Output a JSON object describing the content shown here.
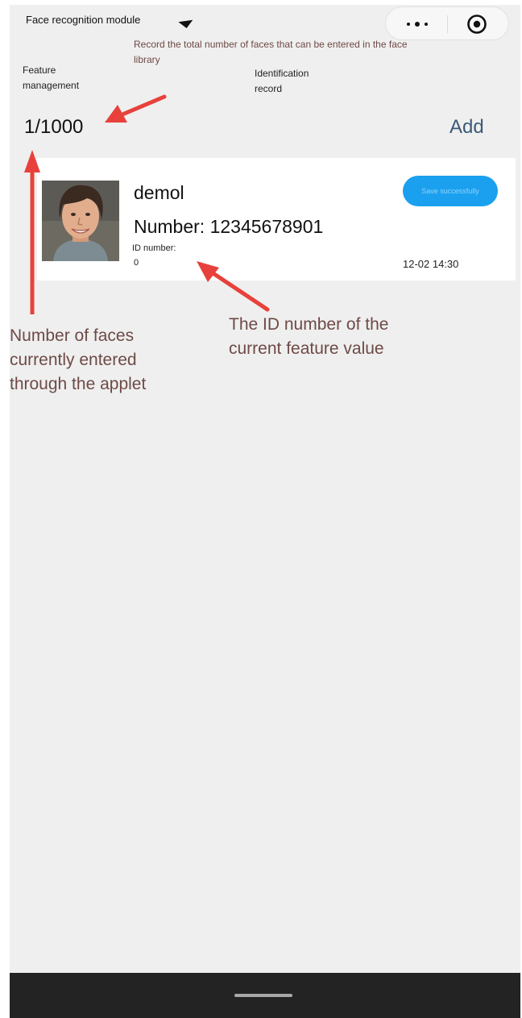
{
  "header": {
    "title": "Face recognition module",
    "tab_feature": "Feature management",
    "tab_record": "Identification record"
  },
  "library": {
    "count_label": "1/1000",
    "add_label": "Add"
  },
  "record": {
    "name": "demol",
    "number": "Number: 12345678901",
    "id_label": "ID number:",
    "id_value": "0",
    "status": "Save successfully",
    "time": "12-02 14:30"
  },
  "annotations": {
    "total_capacity": "Record the total number of faces that can be entered in the face library",
    "current_count": "Number of faces currently entered through the applet",
    "id_number": "The ID number of the current feature value"
  },
  "colors": {
    "annotation_text": "#6e4a46",
    "arrow": "#e8413b",
    "status_button": "#1aa0ee",
    "add_link": "#3c5a78"
  },
  "icons": {
    "capsule_more": "more-dots-icon",
    "capsule_close": "target-close-icon",
    "avatar": "face-photo"
  }
}
